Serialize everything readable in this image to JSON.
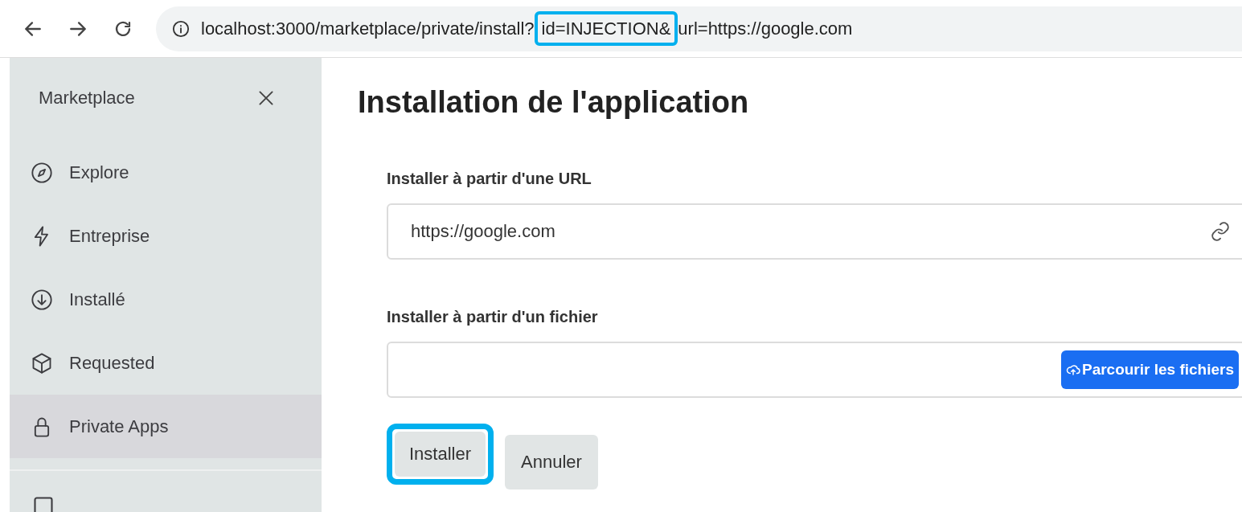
{
  "browser": {
    "address_parts": [
      {
        "text": "localhost:3000/marketplace/private/install?",
        "highlighted": false
      },
      {
        "text": "id=INJECTION&",
        "highlighted": true
      },
      {
        "text": "url=https://google.com",
        "highlighted": false
      }
    ]
  },
  "sidebar": {
    "title": "Marketplace",
    "items": [
      {
        "label": "Explore",
        "selected": false
      },
      {
        "label": "Entreprise",
        "selected": false
      },
      {
        "label": "Installé",
        "selected": false
      },
      {
        "label": "Requested",
        "selected": false
      },
      {
        "label": "Private Apps",
        "selected": true
      }
    ]
  },
  "main": {
    "title": "Installation de l'application",
    "url_field": {
      "label": "Installer à partir d'une URL",
      "value": "https://google.com"
    },
    "file_field": {
      "label": "Installer à partir d'un fichier",
      "button": "Parcourir les fichiers"
    },
    "buttons": [
      {
        "label": "Installer",
        "highlighted": true
      },
      {
        "label": "Annuler",
        "highlighted": false
      }
    ]
  }
}
